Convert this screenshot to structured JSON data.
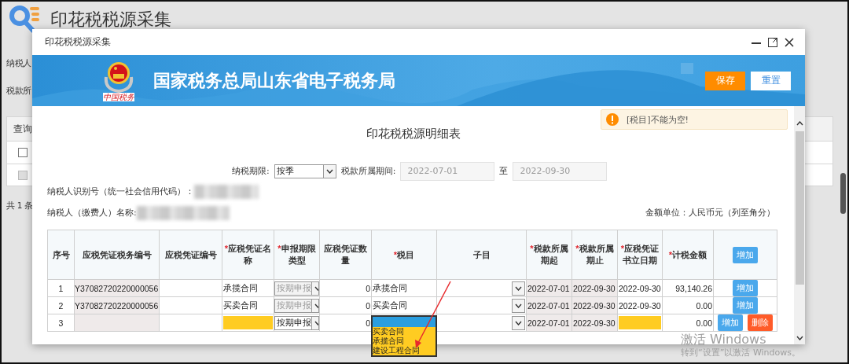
{
  "page": {
    "title": "印花税税源采集",
    "labels": [
      "纳税人",
      "税款所"
    ],
    "list_header": "查询",
    "list_rows": [
      {
        "checked": false,
        "disabled": false
      },
      {
        "checked": false,
        "disabled": true
      }
    ],
    "total": "共 1 条"
  },
  "dialog": {
    "title": "印花税税源采集",
    "banner": {
      "org": "国家税务总局山东省电子税务局",
      "emblem_caption": "中国税务"
    },
    "buttons": [
      {
        "label": "保存",
        "kind": "primary"
      },
      {
        "label": "重置",
        "kind": "secondary"
      }
    ],
    "alert": {
      "kind": "warning",
      "text": "[税目]不能为空!"
    },
    "form": {
      "title": "印花税税源明细表",
      "period_label": "纳税期限:",
      "period_value": "按季",
      "range_label": "税款所属期间:",
      "range_start": "2022-07-01",
      "range_sep": "至",
      "range_end": "2022-09-30",
      "taxpayer_id_label": "纳税人识别号（统一社会信用代码）：",
      "taxpayer_name_label": "纳税人（缴费人）名称:",
      "unit": "金额单位：人民币元（列至角分）"
    },
    "table": {
      "columns": [
        {
          "label": "序号"
        },
        {
          "label": "应税凭证税务编号"
        },
        {
          "label": "应税凭证编号"
        },
        {
          "label": "应税凭证名称",
          "required_mark": "*"
        },
        {
          "label": "申报期限类型",
          "required_mark": "*"
        },
        {
          "label": "应税凭证数量"
        },
        {
          "label": "税目",
          "required_mark": "*"
        },
        {
          "label": "子目"
        },
        {
          "label": "税款所属期起",
          "required_mark": "*"
        },
        {
          "label": "税款所属期止",
          "required_mark": "*"
        },
        {
          "label": "应税凭证书立日期",
          "required_mark": "*"
        },
        {
          "label": "计税金额",
          "required_mark": "*"
        }
      ],
      "header_action": "增加",
      "rows": [
        {
          "seq": "1",
          "tax_no": "Y37082720220000056",
          "voucher_name": "承揽合同",
          "voucher_name_missing": false,
          "period_type": "按期申报",
          "period_type_disabled": true,
          "quantity": "0",
          "tax_item": "承揽合同",
          "start": "2022-07-01",
          "end": "2022-09-30",
          "sign_date": "2022-09-30",
          "sign_date_missing": false,
          "amount": "93,140.26",
          "actions": [
            {
              "label": "增加",
              "kind": "add"
            }
          ]
        },
        {
          "seq": "2",
          "tax_no": "Y37082720220000056",
          "voucher_name": "买卖合同",
          "voucher_name_missing": false,
          "period_type": "按期申报",
          "period_type_disabled": true,
          "quantity": "0",
          "tax_item": "买卖合同",
          "start": "2022-07-01",
          "end": "2022-09-30",
          "sign_date": "2022-09-30",
          "sign_date_missing": false,
          "amount": "0.00",
          "actions": [
            {
              "label": "增加",
              "kind": "add"
            }
          ]
        },
        {
          "seq": "3",
          "voucher_name_missing": true,
          "period_type": "按期申报",
          "period_type_disabled": false,
          "quantity": "0",
          "dropdown": {
            "blank_highlighted": true,
            "options": [
              "买卖合同",
              "承揽合同",
              "建设工程合同"
            ]
          },
          "start": "2022-07-01",
          "end": "2022-09-30",
          "sign_date_missing": true,
          "amount": "0.00",
          "actions": [
            {
              "label": "增加",
              "kind": "add"
            },
            {
              "label": "删除",
              "kind": "delete"
            }
          ]
        }
      ]
    }
  },
  "os_notice": [
    "激活 Windows",
    "转到“设置”以激活 Windows。"
  ]
}
